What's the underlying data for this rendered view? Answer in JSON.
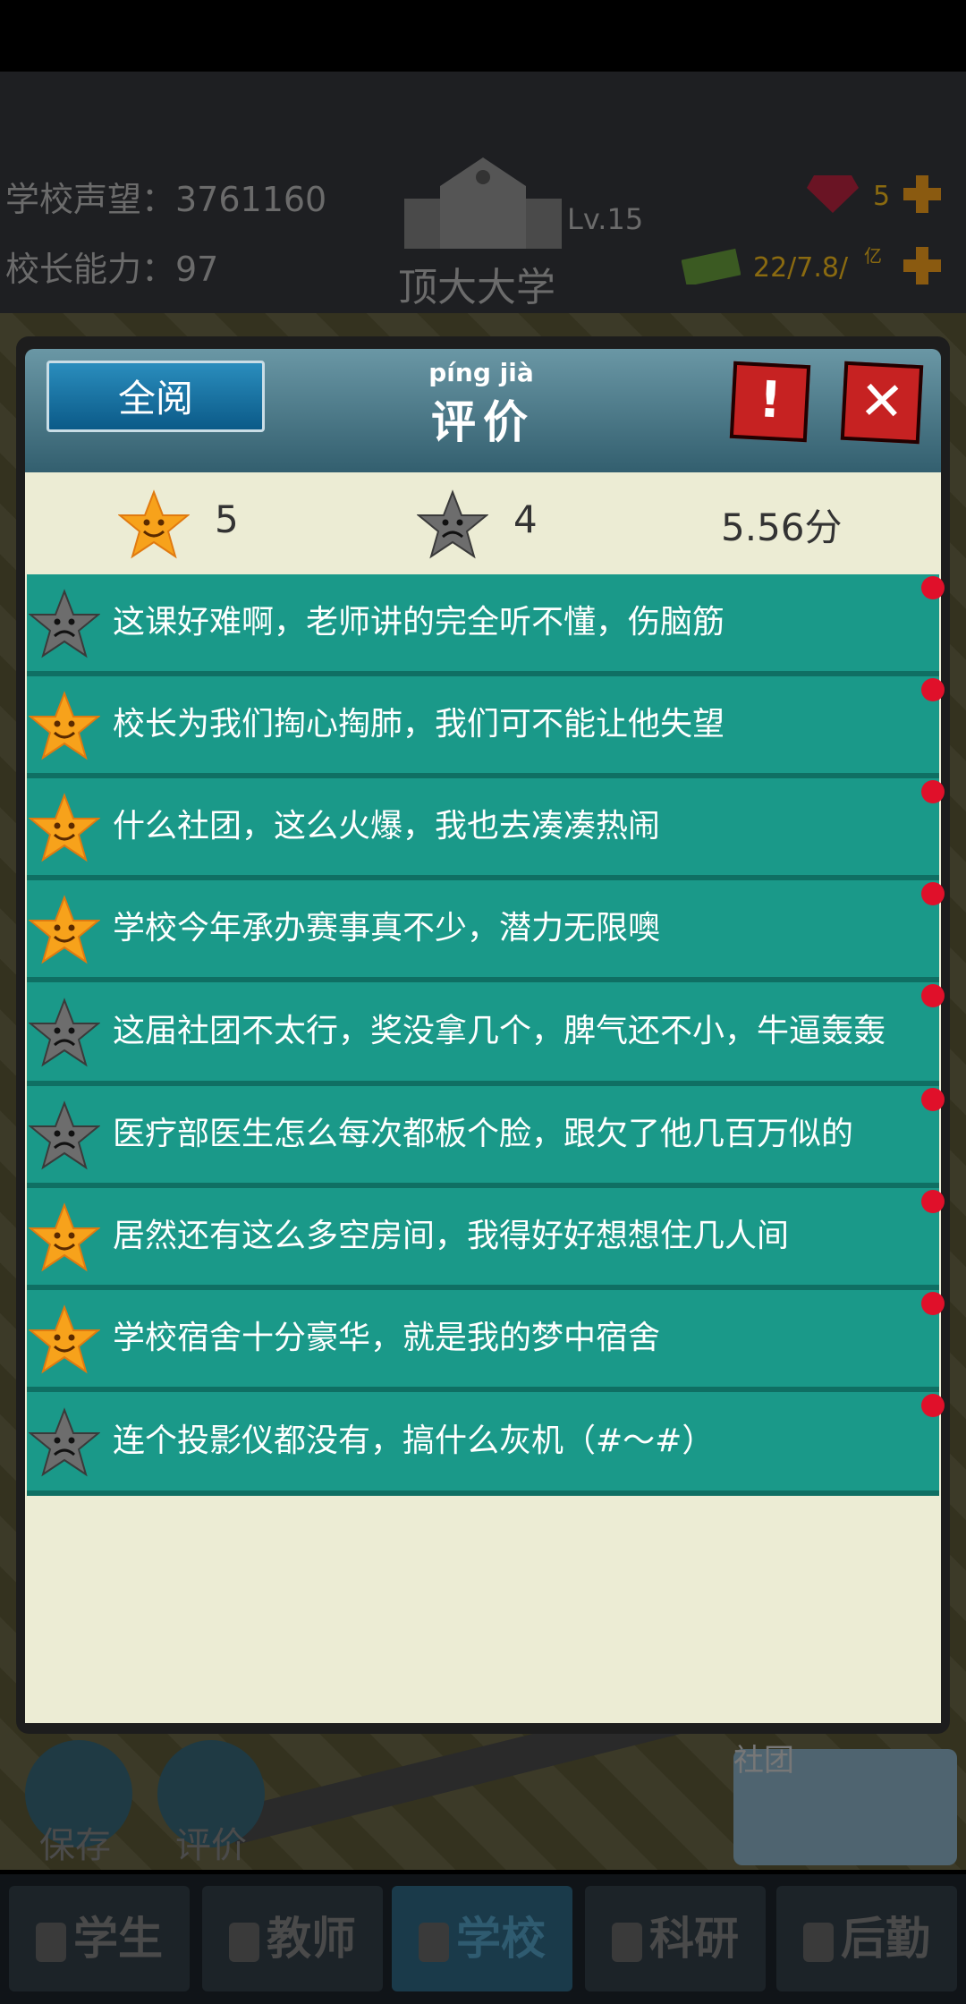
{
  "hud": {
    "reputation": "学校声望：3761160",
    "principal": "校长能力：97",
    "school_name": "顶大大学",
    "level": "Lv.15",
    "gems": "5",
    "money": "22/7.8/",
    "money_unit": "亿"
  },
  "background": {
    "save_label": "保存",
    "review_label": "评价",
    "club_label": "社团"
  },
  "dialog": {
    "read_all": "全阅",
    "title_pinyin": "píng jià",
    "title": "评价",
    "warn_icon": "!",
    "close_icon": "✕",
    "good_count": "5",
    "bad_count": "4",
    "score": "5.56分"
  },
  "reviews": [
    {
      "type": "bad",
      "text": "这课好难啊，老师讲的完全听不懂，伤脑筋"
    },
    {
      "type": "good",
      "text": "校长为我们掏心掏肺，我们可不能让他失望"
    },
    {
      "type": "good",
      "text": "什么社团，这么火爆，我也去凑凑热闹"
    },
    {
      "type": "good",
      "text": "学校今年承办赛事真不少，潜力无限噢"
    },
    {
      "type": "bad",
      "text": "这届社团不太行，奖没拿几个，脾气还不小，牛逼轰轰"
    },
    {
      "type": "bad",
      "text": "医疗部医生怎么每次都板个脸，跟欠了他几百万似的"
    },
    {
      "type": "good",
      "text": "居然还有这么多空房间，我得好好想想住几人间"
    },
    {
      "type": "good",
      "text": "学校宿舍十分豪华，就是我的梦中宿舍"
    },
    {
      "type": "bad",
      "text": "连个投影仪都没有，搞什么灰机（#～#）"
    }
  ],
  "nav": {
    "students": "学生",
    "teachers": "教师",
    "school": "学校",
    "research": "科研",
    "logistics": "后勤"
  }
}
